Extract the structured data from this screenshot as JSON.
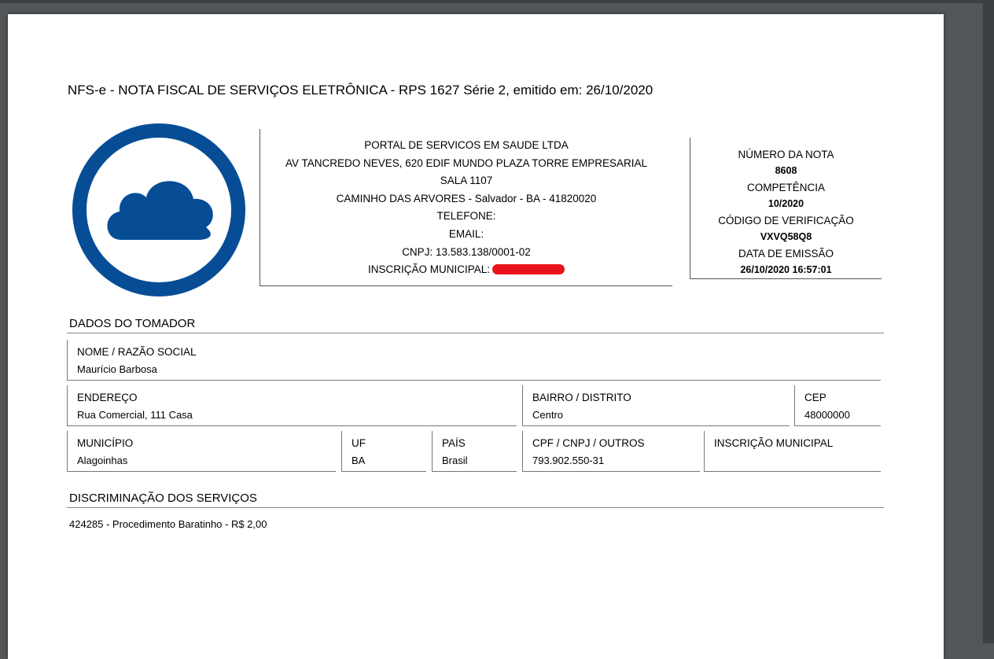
{
  "document": {
    "title": "NFS-e - NOTA FISCAL DE SERVIÇOS ELETRÔNICA  -  RPS 1627 Série 2, emitido em: 26/10/2020"
  },
  "logo": {
    "icon": "cloud-icon",
    "color": "#064d96"
  },
  "prestador": {
    "name": "PORTAL DE SERVICOS EM SAUDE LTDA",
    "address1": "AV TANCREDO NEVES, 620 EDIF MUNDO PLAZA TORRE EMPRESARIAL",
    "address2": "SALA 1107",
    "address3": "CAMINHO DAS ARVORES - Salvador - BA - 41820020",
    "telefone": "TELEFONE:",
    "email": "EMAIL:",
    "cnpj": "CNPJ: 13.583.138/0001-02",
    "inscricao_label": "INSCRIÇÃO MUNICIPAL:"
  },
  "nota": {
    "numero_label": "NÚMERO DA NOTA",
    "numero": "8608",
    "competencia_label": "COMPETÊNCIA",
    "competencia": "10/2020",
    "codigo_label": "CÓDIGO DE VERIFICAÇÃO",
    "codigo": "VXVQ58Q8",
    "data_label": "DATA DE EMISSÃO",
    "data": "26/10/2020 16:57:01"
  },
  "tomador": {
    "section_title": "DADOS DO TOMADOR",
    "nome_label": "NOME / RAZÃO SOCIAL",
    "nome": "Maurício Barbosa",
    "endereco_label": "ENDEREÇO",
    "endereco": "Rua Comercial, 111 Casa",
    "bairro_label": "BAIRRO / DISTRITO",
    "bairro": "Centro",
    "cep_label": "CEP",
    "cep": "48000000",
    "municipio_label": "MUNICÍPIO",
    "municipio": "Alagoinhas",
    "uf_label": "UF",
    "uf": "BA",
    "pais_label": "PAÍS",
    "pais": "Brasil",
    "cpf_label": "CPF / CNPJ / OUTROS",
    "cpf": "793.902.550-31",
    "inscricao_label": "INSCRIÇÃO MUNICIPAL",
    "inscricao": ""
  },
  "servicos": {
    "section_title": "DISCRIMINAÇÃO DOS SERVIÇOS",
    "text": "424285 - Procedimento Baratinho - R$ 2,00"
  }
}
